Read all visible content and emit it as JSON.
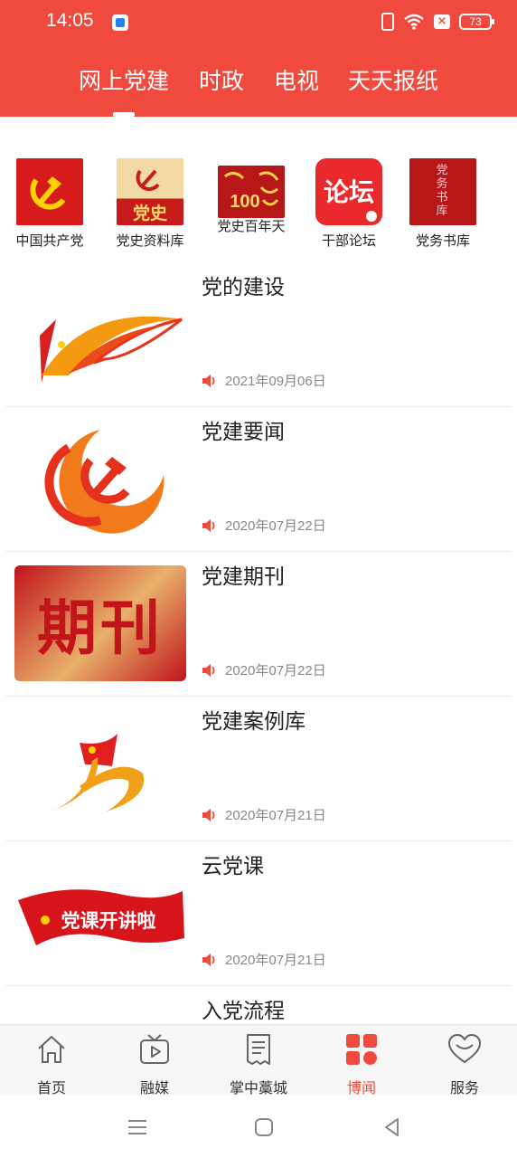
{
  "status": {
    "time": "14:05",
    "battery": "73"
  },
  "colors": {
    "brand": "#f04a3f",
    "active_nav": "#f04a3f",
    "date_grey": "#888888"
  },
  "top_tabs": [
    {
      "label": "网上党建",
      "active": true
    },
    {
      "label": "时政"
    },
    {
      "label": "电视"
    },
    {
      "label": "天天报纸"
    }
  ],
  "quick": [
    {
      "label": "中国共产党",
      "icon": "party-flag-icon"
    },
    {
      "label": "党史资料库",
      "icon": "party-history-icon",
      "art_text": "党史"
    },
    {
      "label": "党史百年天",
      "icon": "centenary-icon",
      "art_text": "100"
    },
    {
      "label": "干部论坛",
      "icon": "forum-icon",
      "art_text": "论坛"
    },
    {
      "label": "党务书库",
      "icon": "book-library-icon",
      "art_text": "党务书库"
    }
  ],
  "articles": [
    {
      "title": "党的建设",
      "date": "2021年09月06日",
      "thumb": "party-building-banner"
    },
    {
      "title": "党建要闻",
      "date": "2020年07月22日",
      "thumb": "party-emblem-circle"
    },
    {
      "title": "党建期刊",
      "date": "2020年07月22日",
      "thumb": "periodical-calligraphy",
      "art_text": "期刊"
    },
    {
      "title": "党建案例库",
      "date": "2020年07月21日",
      "thumb": "case-library-logo"
    },
    {
      "title": "云党课",
      "date": "2020年07月21日",
      "thumb": "cloud-lesson-banner",
      "art_text": "党课开讲啦"
    },
    {
      "title": "入党流程",
      "date": "",
      "thumb": "join-party-image"
    }
  ],
  "bottom_nav": [
    {
      "label": "首页",
      "icon": "home-icon"
    },
    {
      "label": "融媒",
      "icon": "tv-icon"
    },
    {
      "label": "掌中藁城",
      "icon": "document-icon"
    },
    {
      "label": "博闻",
      "icon": "grid-icon",
      "active": true
    },
    {
      "label": "服务",
      "icon": "heart-icon"
    }
  ]
}
